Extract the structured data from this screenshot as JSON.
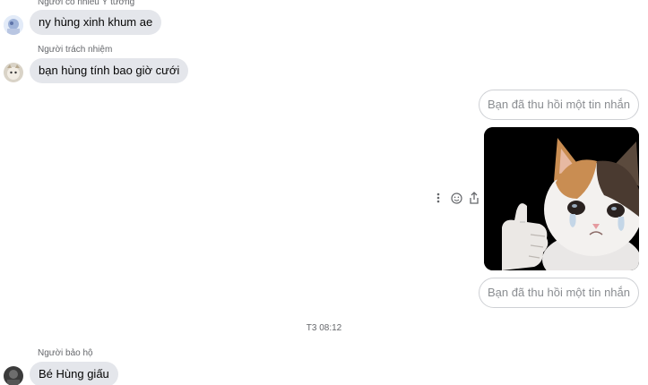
{
  "messages": {
    "m1": {
      "sender": "Người có nhiều Ý tưởng",
      "text": "ny hùng xinh khum ae"
    },
    "m2": {
      "sender": "Người trách nhiệm",
      "text": "bạn hùng tính bao giờ cưới"
    },
    "recalled_1": "Bạn đã thu hồi một tin nhắn",
    "recalled_2": "Bạn đã thu hồi một tin nhắn",
    "timestamp": "T3 08:12",
    "m3": {
      "sender": "Người bảo hộ",
      "text": "Bé Hùng giấu"
    }
  },
  "icons": {
    "more": "more-vertical-icon",
    "react": "smiley-icon",
    "share": "share-icon"
  },
  "colors": {
    "incoming_bubble": "#e4e6eb",
    "recalled_border": "#ced0d4",
    "recalled_text": "#8a8d91",
    "secondary_text": "#65676b"
  }
}
